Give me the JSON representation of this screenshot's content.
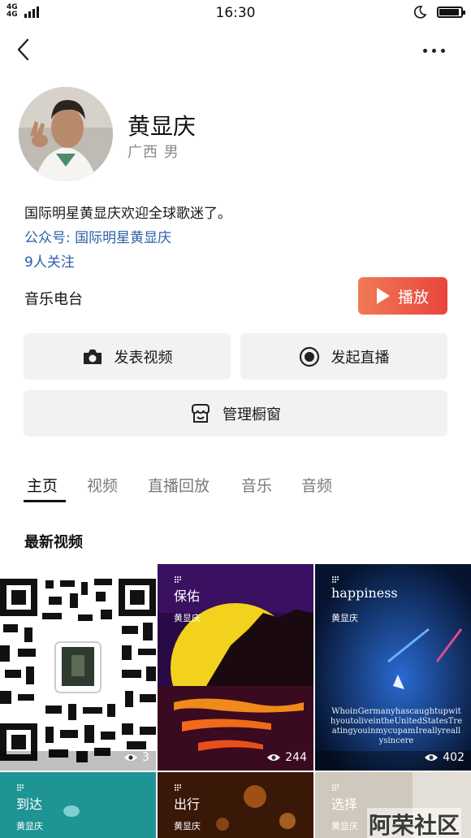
{
  "status_bar": {
    "network": "4G 4G",
    "time": "16:30"
  },
  "profile": {
    "name": "黄显庆",
    "location_gender": "广西 男",
    "bio": "国际明星黄显庆欢迎全球歌迷了。",
    "official_account": "公众号: 国际明星黄显庆",
    "followers": "9人关注"
  },
  "radio": {
    "label": "音乐电台",
    "play_label": "播放"
  },
  "actions": {
    "post_video": "发表视频",
    "start_live": "发起直播",
    "manage_shop": "管理橱窗"
  },
  "tabs": [
    "主页",
    "视频",
    "直播回放",
    "音乐",
    "音频"
  ],
  "section_title": "最新视频",
  "videos": [
    {
      "title": "",
      "author": "",
      "views": "3"
    },
    {
      "title": "保佑",
      "author": "黄显庆",
      "views": "244"
    },
    {
      "title": "happiness",
      "author": "黄显庆",
      "views": "402",
      "lyric": "WhoinGermanyhascaughtupwithyoutoliveintheUnitedStatesTreatingyouinmycupamIreallyreallysincere"
    },
    {
      "title": "到达",
      "author": "黄显庆"
    },
    {
      "title": "出行",
      "author": "黄显庆"
    },
    {
      "title": "选择",
      "author": "黄显庆"
    }
  ],
  "watermark": "阿荣社区",
  "colors": {
    "accent_link": "#2b5fa6",
    "play_gradient_start": "#f07a55",
    "play_gradient_end": "#e8453d",
    "button_bg": "#f2f2f2"
  },
  "icons": [
    "back-icon",
    "more-icon",
    "camera-icon",
    "live-record-icon",
    "shop-icon",
    "play-icon",
    "eye-icon",
    "moon-icon",
    "battery-icon"
  ]
}
